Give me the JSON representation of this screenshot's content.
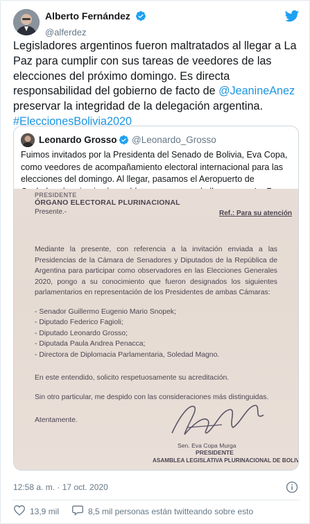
{
  "author": {
    "name": "Alberto Fernández",
    "handle": "@alferdez"
  },
  "tweet": {
    "text_part1": "Legisladores argentinos fueron maltratados al llegar a La Paz para cumplir con sus tareas de veedores de las elecciones del próximo domingo. Es directa responsabilidad del gobierno de facto de ",
    "mention": "@JeanineAnez",
    "text_part2": " preservar la integridad de la delegación argentina.",
    "hashtag": "#EleccionesBolivia2020"
  },
  "quote": {
    "name": "Leonardo Grosso",
    "handle": "@Leonardo_Grosso",
    "text": "Fuimos invitados por la Presidenta del Senado de Bolivia, Eva Copa, como veedores de acompañamiento electoral internacional para las elecciones del domingo. Al llegar, pasamos el Aeropuerto de Cochabamba sin ningún problema, pero cuando llegamos a La Paz nos detuvieron."
  },
  "document": {
    "line1": "PRESIDENTE",
    "line2": "ÓRGANO ELECTORAL PLURINACIONAL",
    "line3": "Presente.-",
    "ref": "Ref.: Para su atención",
    "paragraph": "Mediante la presente, con referencia a la invitación enviada a las Presidencias de la Cámara de Senadores y Diputados de la República de Argentina para participar como observadores en las Elecciones Generales 2020, pongo a su conocimiento que fueron designados los siguientes parlamentarios en representación de los Presidentes de ambas Cámaras:",
    "list": [
      "- Senador Guillermo Eugenio Mario Snopek;",
      "- Diputado Federico Fagioli;",
      "- Diputado Leonardo Grosso;",
      "- Diputada Paula Andrea Penacca;",
      "- Directora de Diplomacia Parlamentaria, Soledad Magno."
    ],
    "closing1": "En este entendido, solicito respetuosamente su acreditación.",
    "closing2": "Sin otro particular, me despido con las consideraciones más distinguidas.",
    "farewell": "Atentamente.",
    "sig_name": "Sen. Eva Copa Murga",
    "sig_title": "PRESIDENTE",
    "sig_org": "ASAMBLEA LEGISLATIVA PLURINACIONAL DE BOLIVIA"
  },
  "meta": {
    "timestamp": "12:58 a. m. · 17 oct. 2020",
    "likes": "13,9 mil",
    "tweeting": "8,5 mil personas están twitteando sobre esto"
  },
  "colors": {
    "link": "#1b95e0",
    "verified": "#1da1f2",
    "like_red": "#e0245e"
  },
  "icons": [
    "verified-icon",
    "twitter-bird-icon",
    "info-icon",
    "heart-icon",
    "speech-bubble-icon"
  ]
}
